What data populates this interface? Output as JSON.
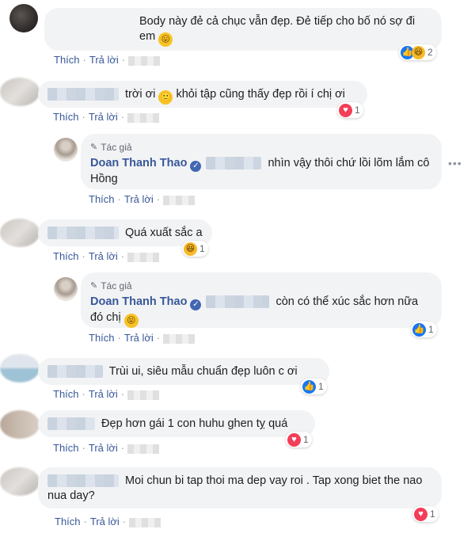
{
  "comments": [
    {
      "text": "Body này đẻ cả chục vẫn đẹp. Đẻ tiếp cho bố nó sợ đi em",
      "like": "Thích",
      "reply": "Trả lời",
      "reaction_count": "2"
    },
    {
      "text": "trời ơi",
      "text2": "khỏi tập cũng thấy đẹp rồi í chị ơi",
      "like": "Thích",
      "reply": "Trả lời",
      "reaction_count": "1"
    },
    {
      "author_tag": "Tác giả",
      "author": "Doan Thanh Thao",
      "text": "nhìn vậy thôi chứ lồi lõm lắm cô Hồng",
      "like": "Thích",
      "reply": "Trả lời"
    },
    {
      "text": "Quá xuất sắc a",
      "like": "Thích",
      "reply": "Trả lời",
      "reaction_count": "1"
    },
    {
      "author_tag": "Tác giả",
      "author": "Doan Thanh Thao",
      "text": "còn có thể xúc sắc hơn nữa đó chị",
      "like": "Thích",
      "reply": "Trả lời",
      "reaction_count": "1"
    },
    {
      "text": "Trùi ui, siêu mẫu chuẩn đẹp luôn c ơi",
      "like": "Thích",
      "reply": "Trả lời",
      "reaction_count": "1"
    },
    {
      "text": "Đẹp hơn gái 1 con huhu ghen tỵ quá",
      "like": "Thích",
      "reply": "Trả lời",
      "reaction_count": "1"
    },
    {
      "text": "Moi chun bi tap thoi ma dep vay roi . Tap xong biet the nao nua day?",
      "like": "Thích",
      "reply": "Trả lời",
      "reaction_count": "1"
    }
  ],
  "icons": {
    "like": "like-reaction-icon",
    "heart": "love-reaction-icon",
    "haha": "haha-reaction-icon",
    "verified": "verified-badge-icon",
    "more": "more-options-icon"
  },
  "colors": {
    "link": "#385898",
    "bubble": "#f2f3f5",
    "like": "#1877f2",
    "heart": "#f33e58"
  }
}
